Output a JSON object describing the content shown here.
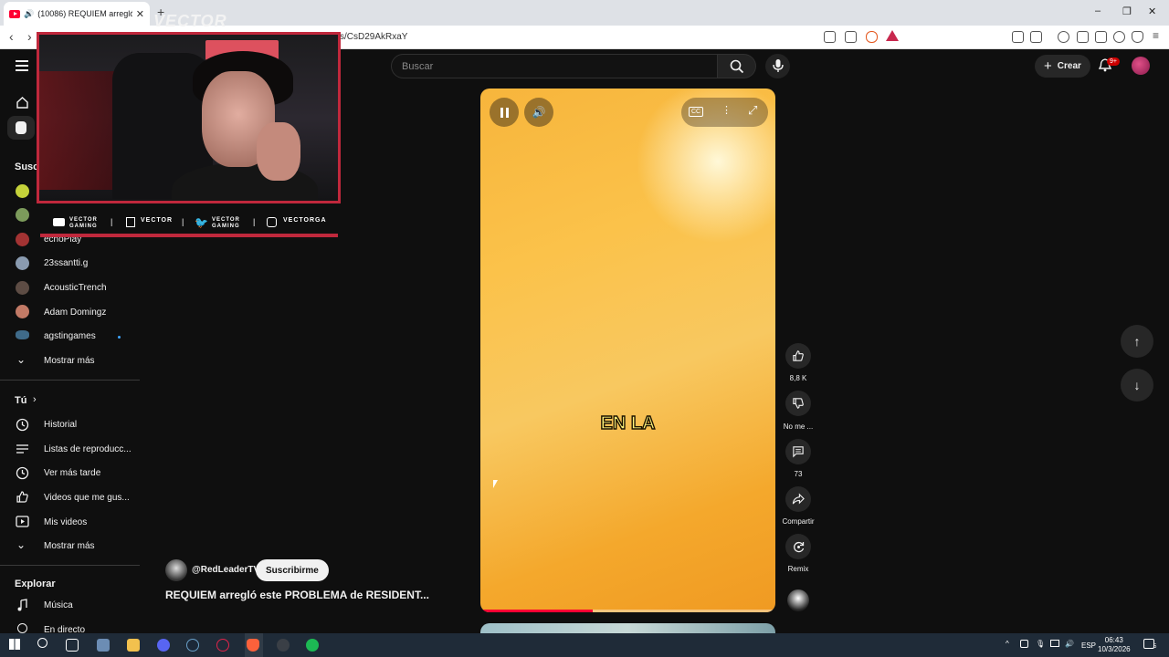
{
  "browser": {
    "tab_title": "(10086) REQUIEM arregló este",
    "new_tab": "+",
    "url": "s/CsD29AkRxaY",
    "window_controls": {
      "minimize": "–",
      "restore": "❐",
      "close": "✕"
    }
  },
  "header": {
    "search_placeholder": "Buscar",
    "create_label": "Crear",
    "notifications_badge": "9+"
  },
  "sidebar": {
    "subscriptions_title": "Susc",
    "channels": [
      {
        "name": "",
        "color": "#c5d23a"
      },
      {
        "name": "",
        "color": "#7c9b5b"
      },
      {
        "name": "echoPlay",
        "color": "#a33333"
      },
      {
        "name": "23ssantti.g",
        "color": "#8a9bb0"
      },
      {
        "name": "AcousticTrench",
        "color": "#5d4c44"
      },
      {
        "name": "Adam Domingz",
        "color": "#c27a66"
      },
      {
        "name": "agstingames",
        "color": "#3f6b8a"
      }
    ],
    "show_more_subs": "Mostrar más",
    "you_title": "Tú",
    "you_items": [
      "Historial",
      "Listas de reproducc...",
      "Ver más tarde",
      "Videos que me gus...",
      "Mis videos"
    ],
    "show_more_you": "Mostrar más",
    "explore_title": "Explorar",
    "explore_items": [
      "Música",
      "En directo"
    ]
  },
  "overlay": {
    "logo_text": "VECTOR",
    "socials": [
      {
        "icon": "youtube-icon",
        "text": "VECTOR GAMING"
      },
      {
        "icon": "twitch-icon",
        "text": "VECTOR"
      },
      {
        "icon": "twitter-icon",
        "text": "VECTOR GAMING"
      },
      {
        "icon": "instagram-icon",
        "text": "VECTORGA"
      }
    ]
  },
  "player": {
    "caption": "EN LA",
    "cc_label": "CC",
    "progress": 0.38
  },
  "video": {
    "channel_handle": "@RedLeaderTV",
    "subscribe_label": "Suscribirme",
    "title": "REQUIEM arregló este PROBLEMA de RESIDENT..."
  },
  "actions": {
    "likes": "8,8 K",
    "dislike_label": "No me ...",
    "comments": "73",
    "share_label": "Compartir",
    "remix_label": "Remix"
  },
  "taskbar": {
    "language": "ESP",
    "time": "06:43",
    "date": "10/3/2026",
    "notif_count": "5"
  },
  "colors": {
    "accent_red": "#ff0033",
    "overlay_red": "#c0283c",
    "background": "#0f0f0f"
  }
}
